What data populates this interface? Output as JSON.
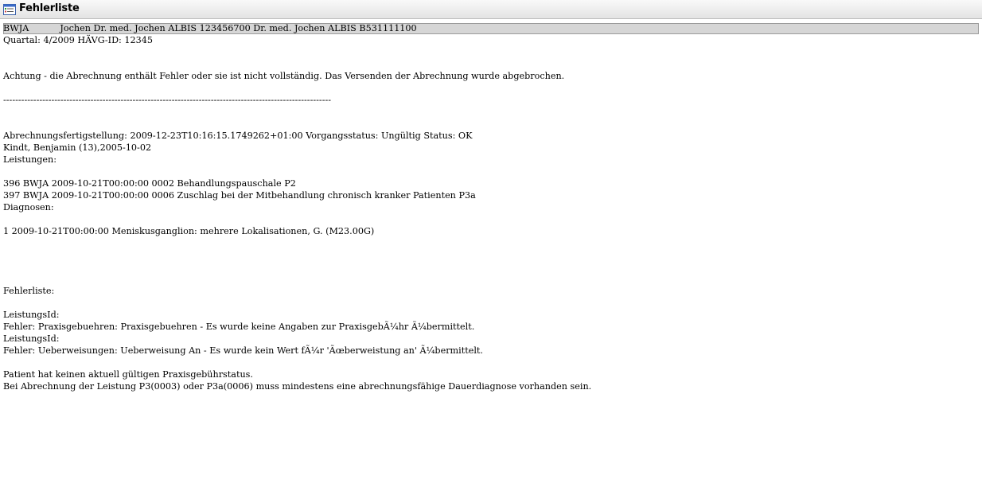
{
  "window": {
    "title": "Fehlerliste",
    "icon": "list-window-icon"
  },
  "lines": [
    "BWJA           Jochen Dr. med. Jochen ALBIS 123456700 Dr. med. Jochen ALBIS B531111100",
    "Quartal: 4/2009 HÄVG-ID: 12345",
    "",
    "",
    "Achtung - die Abrechnung enthält Fehler oder sie ist nicht vollständig. Das Versenden der Abrechnung wurde abgebrochen.",
    "",
    "-------------------------------------------------------------------------------------------------------------",
    "",
    "",
    "Abrechnungsfertigstellung: 2009-12-23T10:16:15.1749262+01:00 Vorgangsstatus: Ungültig Status: OK",
    "Kindt, Benjamin (13),2005-10-02",
    "Leistungen:",
    "",
    "396 BWJA 2009-10-21T00:00:00 0002 Behandlungspauschale P2",
    "397 BWJA 2009-10-21T00:00:00 0006 Zuschlag bei der Mitbehandlung chronisch kranker Patienten P3a",
    "Diagnosen:",
    "",
    "1 2009-10-21T00:00:00 Meniskusganglion: mehrere Lokalisationen, G. (M23.00G)",
    "",
    "",
    "",
    "",
    "Fehlerliste:",
    "",
    "LeistungsId:",
    "Fehler: Praxisgebuehren: Praxisgebuehren - Es wurde keine Angaben zur PraxisgebÃ¼hr Ã¼bermittelt.",
    "LeistungsId:",
    "Fehler: Ueberweisungen: Ueberweisung An - Es wurde kein Wert fÃ¼r 'Ãœberweistung an' Ã¼bermittelt.",
    "",
    "Patient hat keinen aktuell gültigen Praxisgebührstatus.",
    "Bei Abrechnung der Leistung P3(0003) oder P3a(0006) muss mindestens eine abrechnungsfähige Dauerdiagnose vorhanden sein."
  ]
}
